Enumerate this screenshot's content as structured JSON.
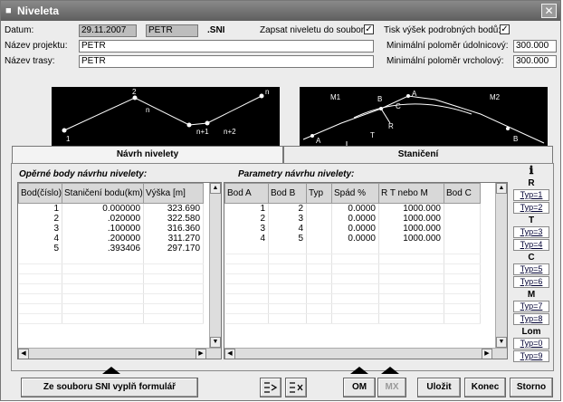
{
  "window": {
    "title": "Niveleta",
    "close": "✕"
  },
  "form": {
    "datum_label": "Datum:",
    "datum_value": "29.11.2007",
    "file_name": "PETR",
    "file_ext": ".SNI",
    "write_label": "Zapsat niveletu do souboru:",
    "write_checked": "✓",
    "print_label": "Tisk výšek podrobných bodů:",
    "print_checked": "✓",
    "project_label": "Název projektu:",
    "project_value": "PETR",
    "route_label": "Název trasy:",
    "route_value": "PETR",
    "min_valley_label": "Minimální poloměr údolnicový:",
    "min_valley_value": "300.000",
    "min_crest_label": "Minimální poloměr vrcholový:",
    "min_crest_value": "300.000"
  },
  "diagram_left": {
    "labels": [
      "1",
      "2",
      "n",
      "n+1",
      "n+2",
      "n"
    ]
  },
  "diagram_right": {
    "labels": [
      "M1",
      "B",
      "A",
      "C",
      "R",
      "T",
      "M2",
      "A",
      "B"
    ]
  },
  "tabs": [
    {
      "label": "Návrh nivelety"
    },
    {
      "label": "Staničení"
    }
  ],
  "points": {
    "title": "Opěrné body návrhu nivelety:",
    "columns": [
      "Bod(číslo)",
      "Staničení bodu(km)",
      "Výška [m]"
    ],
    "rows": [
      [
        "1",
        "0.000000",
        "323.690"
      ],
      [
        "2",
        ".020000",
        "322.580"
      ],
      [
        "3",
        ".100000",
        "316.360"
      ],
      [
        "4",
        ".200000",
        "311.270"
      ],
      [
        "5",
        ".393406",
        "297.170"
      ]
    ]
  },
  "params": {
    "title": "Parametry návrhu nivelety:",
    "columns": [
      "Bod A",
      "Bod B",
      "Typ",
      "Spád %",
      "R T nebo M",
      "Bod C"
    ],
    "rows": [
      [
        "1",
        "2",
        "",
        "0.0000",
        "1000.000",
        ""
      ],
      [
        "2",
        "3",
        "",
        "0.0000",
        "1000.000",
        ""
      ],
      [
        "3",
        "4",
        "",
        "0.0000",
        "1000.000",
        ""
      ],
      [
        "4",
        "5",
        "",
        "0.0000",
        "1000.000",
        ""
      ]
    ]
  },
  "types": {
    "info_icon": "ℹ",
    "groups": [
      {
        "letter": "R",
        "buttons": [
          "Typ=1",
          "Typ=2"
        ]
      },
      {
        "letter": "T",
        "buttons": [
          "Typ=3",
          "Typ=4"
        ]
      },
      {
        "letter": "C",
        "buttons": [
          "Typ=5",
          "Typ=6"
        ]
      },
      {
        "letter": "M",
        "buttons": [
          "Typ=7",
          "Typ=8"
        ]
      },
      {
        "letter": "Lom",
        "buttons": [
          "Typ=0",
          "Typ=9"
        ]
      }
    ]
  },
  "buttons": {
    "fill_form": "Ze souboru SNI vyplň formulář",
    "om": "OM",
    "mx": "MX",
    "save": "Uložit",
    "end": "Konec",
    "cancel": "Storno"
  }
}
